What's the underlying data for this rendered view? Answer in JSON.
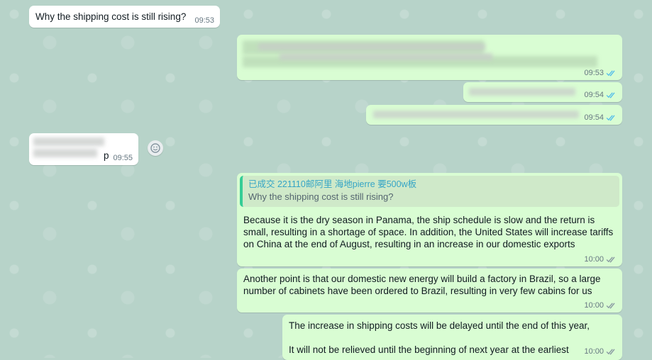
{
  "messages": [
    {
      "text": "Why the shipping cost is still rising?",
      "time": "09:53"
    },
    {
      "time": "09:53"
    },
    {
      "time": "09:54"
    },
    {
      "time": "09:54"
    },
    {
      "text": "p",
      "time": "09:55"
    },
    {
      "quote_author": "已成交 221110邮阿里 海地pierre 要500w板",
      "quote_text": "Why the shipping cost is still rising?",
      "text": "Because it is the dry season in Panama, the ship schedule is slow and the return is small, resulting in a shortage of space. In addition, the United States will increase tariffs on China at the end of August, resulting in an increase in our domestic exports",
      "time": "10:00"
    },
    {
      "text": "Another point is that our domestic new energy will build a factory in Brazil, so a large number of cabinets have been ordered to Brazil, resulting in very few cabins for us",
      "time": "10:00"
    },
    {
      "text": "The increase in shipping costs will be delayed until the end of this year,\n\nIt will not be relieved until the beginning of next year at the earliest",
      "time": "10:00"
    }
  ],
  "icons": {
    "emoji": "emoji-icon",
    "read_tick": "double-check-icon",
    "accent": "#53bdeb"
  }
}
